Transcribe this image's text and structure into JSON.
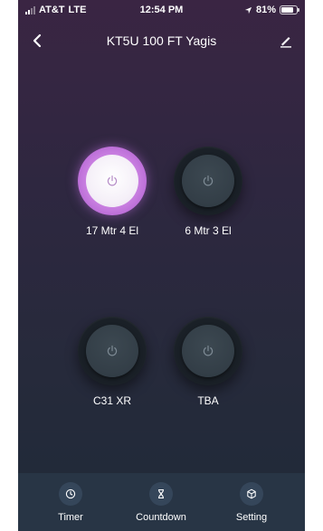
{
  "status_bar": {
    "carrier": "AT&T",
    "network": "LTE",
    "time": "12:54 PM",
    "battery": "81%",
    "battery_level": 0.81
  },
  "header": {
    "title": "KT5U 100 FT Yagis",
    "back_icon": "chevron-left-icon",
    "edit_icon": "pencil-icon"
  },
  "switches": [
    {
      "label": "17 Mtr 4 El",
      "state": "on"
    },
    {
      "label": "6 Mtr 3 El",
      "state": "off"
    },
    {
      "label": "C31 XR",
      "state": "off"
    },
    {
      "label": "TBA",
      "state": "off"
    }
  ],
  "bottom_tabs": [
    {
      "label": "Timer",
      "icon": "clock-icon"
    },
    {
      "label": "Countdown",
      "icon": "hourglass-icon"
    },
    {
      "label": "Setting",
      "icon": "cube-icon"
    }
  ],
  "colors": {
    "on_glow": "#c87ee0",
    "background_top": "#3a2543",
    "background_bottom": "#1f2a38",
    "tab_bar": "#283545"
  }
}
